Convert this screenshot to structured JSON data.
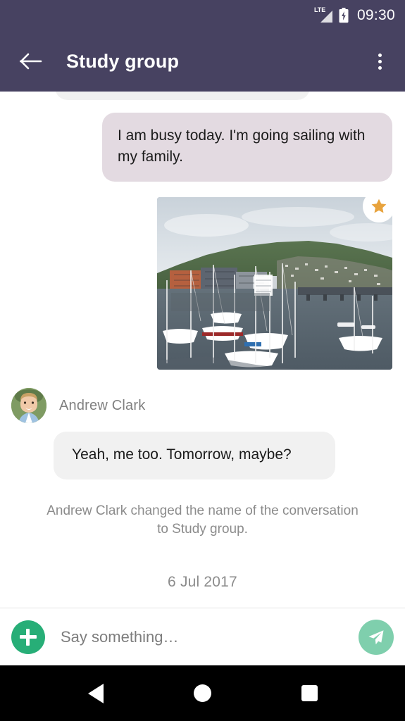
{
  "status_bar": {
    "network_label": "LTE",
    "signal_icon": "signal-bars-icon",
    "battery_icon": "battery-charging-icon",
    "time": "09:30"
  },
  "toolbar": {
    "back_icon": "back-arrow-icon",
    "title": "Study group",
    "overflow_icon": "overflow-menu-icon",
    "background_color": "#474261"
  },
  "conversation": {
    "outgoing_message": "I am busy today. I'm going sailing with my family.",
    "photo": {
      "alt": "harbor-marina-photo",
      "starred_icon": "star-icon",
      "star_color": "#e8a33d"
    },
    "sender": {
      "name": "Andrew Clark",
      "avatar_icon": "user-avatar-photo"
    },
    "incoming_message": "Yeah, me too. Tomorrow, maybe?",
    "system_message": "Andrew Clark changed the name of the conversation to Study group.",
    "date_separator": "6 Jul 2017",
    "bubble_out_color": "#e3dae1",
    "bubble_in_color": "#f1f1f1"
  },
  "input_bar": {
    "attach_icon": "plus-icon",
    "attach_color": "#27ae77",
    "placeholder": "Say something…",
    "value": "",
    "send_icon": "send-paper-plane-icon",
    "send_color": "#7fcfad"
  },
  "nav_bar": {
    "back_icon": "nav-back-triangle-icon",
    "home_icon": "nav-home-circle-icon",
    "recents_icon": "nav-recents-square-icon"
  }
}
